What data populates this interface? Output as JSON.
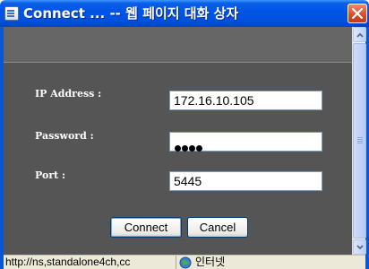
{
  "window": {
    "title": "Connect ... -- 웹 페이지 대화 상자",
    "icon": "dialog-page-icon",
    "close_icon": "close-icon"
  },
  "form": {
    "ip_label": "IP Address  :",
    "ip_value": "172.16.10.105",
    "password_label": "Password :",
    "password_mask_length": 4,
    "port_label": "Port  :",
    "port_value": "5445"
  },
  "buttons": {
    "connect_label": "Connect",
    "cancel_label": "Cancel"
  },
  "statusbar": {
    "url": "http://ns,standalone4ch,cc",
    "zone_icon": "globe-icon",
    "zone_label": "인터넷"
  },
  "colors": {
    "titlebar": "#0055e5",
    "content_bg": "#555555",
    "band_bg": "#666666",
    "close_button": "#d84a24"
  }
}
